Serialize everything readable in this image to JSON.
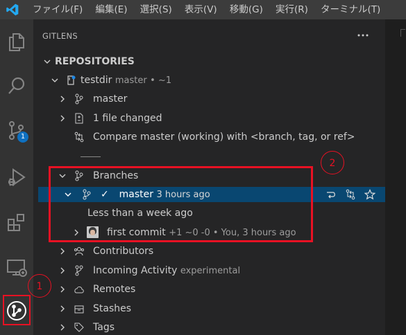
{
  "menu": {
    "items": [
      "ファイル(F)",
      "編集(E)",
      "選択(S)",
      "表示(V)",
      "移動(G)",
      "実行(R)",
      "ターミナル(T)"
    ]
  },
  "activity_bar": {
    "icons": [
      "explorer-icon",
      "search-icon",
      "source-control-icon",
      "run-debug-icon",
      "extensions-icon",
      "remote-explorer-icon",
      "gitlens-icon"
    ],
    "source_control_badge": "1"
  },
  "sidebar": {
    "title": "GITLENS",
    "section_title": "REPOSITORIES",
    "repo": {
      "name": "testdir",
      "branch": "master",
      "status": "•  ~1"
    },
    "items": {
      "branch": "master",
      "files_changed": "1 file changed",
      "compare": "Compare master (working) with <branch, tag, or ref>",
      "branches": "Branches",
      "selected_branch": {
        "check": "✓",
        "name": "master",
        "time": "3 hours ago"
      },
      "group": "Less than a week ago",
      "commit": {
        "message": "first commit",
        "details": "+1 ~0 -0  •  You, 3 hours ago"
      },
      "contributors": "Contributors",
      "incoming": {
        "label": "Incoming Activity",
        "tag": "experimental"
      },
      "remotes": "Remotes",
      "stashes": "Stashes",
      "tags": "Tags"
    }
  },
  "annotations": {
    "callout_1": "1",
    "callout_2": "2"
  },
  "colors": {
    "accent": "#094771",
    "badge": "#0e70c0",
    "annotation": "#e81123"
  }
}
